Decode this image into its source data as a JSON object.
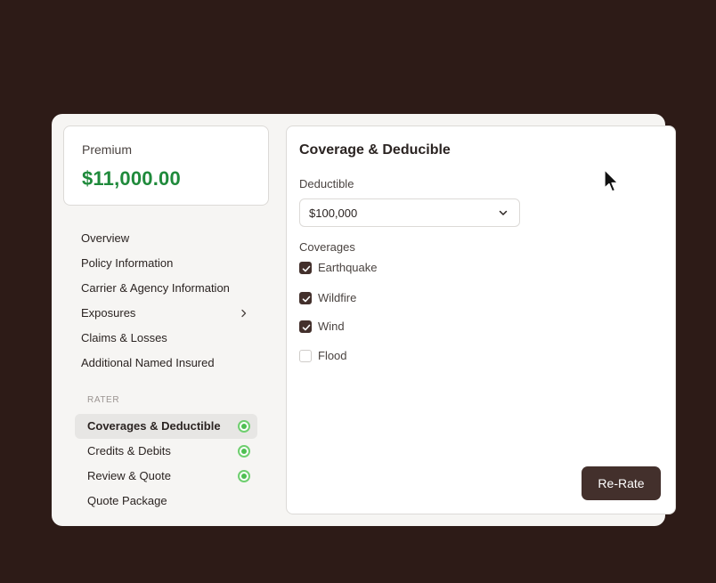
{
  "premium": {
    "label": "Premium",
    "value": "$11,000.00",
    "color": "#1f8a3b"
  },
  "nav": {
    "items": [
      {
        "label": "Overview"
      },
      {
        "label": "Policy Information"
      },
      {
        "label": "Carrier & Agency Information"
      },
      {
        "label": "Exposures",
        "icon": "chevron-right-icon"
      },
      {
        "label": "Claims & Losses"
      },
      {
        "label": "Additional Named Insured"
      }
    ]
  },
  "rater": {
    "section_label": "RATER",
    "items": [
      {
        "label": "Coverages & Deductible",
        "active": true,
        "complete": true
      },
      {
        "label": "Credits & Debits",
        "complete": true
      },
      {
        "label": "Review & Quote",
        "complete": true
      },
      {
        "label": "Quote Package",
        "complete": false
      }
    ]
  },
  "panel": {
    "title": "Coverage & Deducible",
    "deductible_label": "Deductible",
    "deductible_value": "$100,000",
    "coverages_label": "Coverages",
    "coverages": [
      {
        "label": "Earthquake",
        "checked": true
      },
      {
        "label": "Wildfire",
        "checked": true
      },
      {
        "label": "Wind",
        "checked": true
      },
      {
        "label": "Flood",
        "checked": false
      }
    ],
    "rerate_label": "Re-Rate"
  },
  "colors": {
    "accent": "#43302c",
    "status_green": "#4fbf52",
    "background": "#2d1b17"
  }
}
